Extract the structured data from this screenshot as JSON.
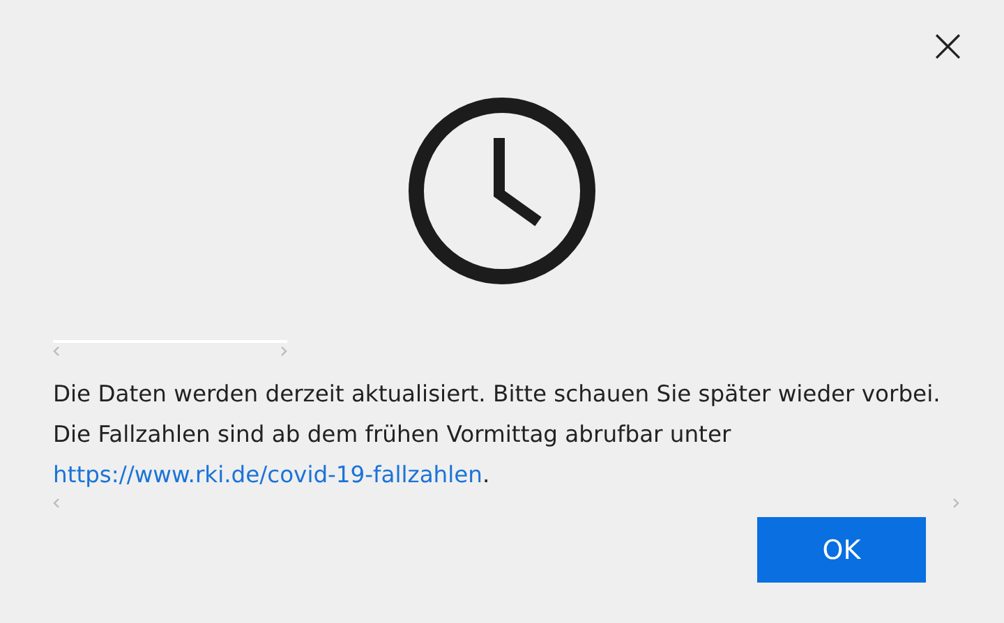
{
  "close_button": {
    "label": "×"
  },
  "message": {
    "text": "Die Daten werden derzeit aktualisiert. Bitte schauen Sie später wieder vorbei. Die Fallzahlen sind ab dem frühen Vormittag abrufbar unter ",
    "link": "https://www.rki.de/covid-19-fallzahlen",
    "after": "."
  },
  "buttons": [
    {
      "label": "OK"
    }
  ]
}
